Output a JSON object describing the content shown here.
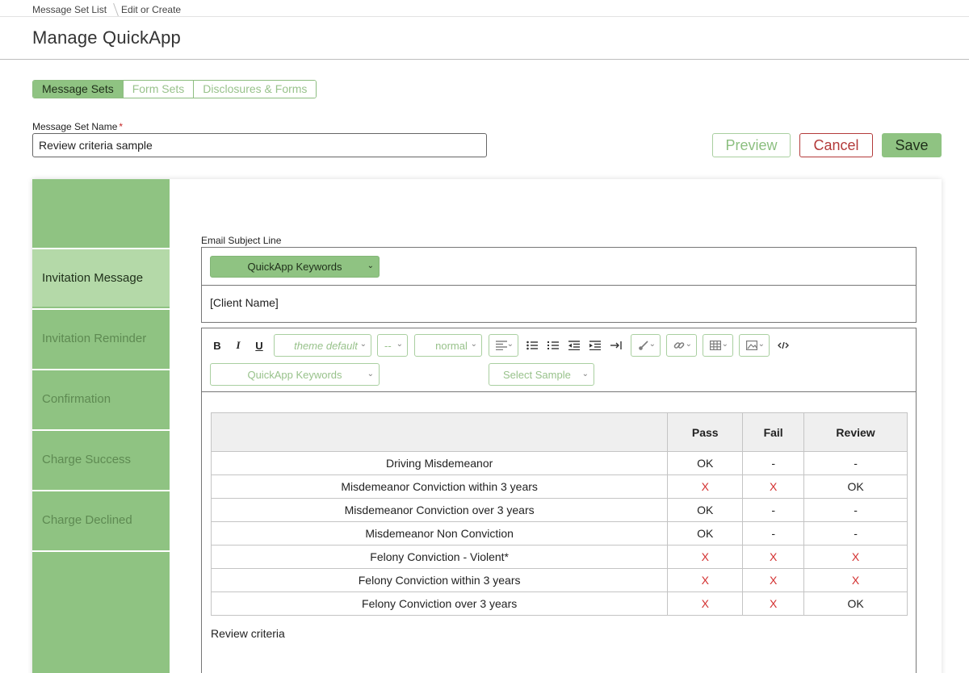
{
  "breadcrumb": {
    "items": [
      "Message Set List",
      "Edit or Create"
    ]
  },
  "page": {
    "title": "Manage QuickApp"
  },
  "tabs": [
    {
      "label": "Message Sets",
      "active": true
    },
    {
      "label": "Form Sets",
      "active": false
    },
    {
      "label": "Disclosures & Forms",
      "active": false
    }
  ],
  "form": {
    "name_label": "Message Set Name",
    "required_mark": "*",
    "name_value": "Review criteria sample"
  },
  "actions": {
    "preview": "Preview",
    "cancel": "Cancel",
    "save": "Save"
  },
  "sidebar": {
    "items": [
      {
        "label": "Invitation Message",
        "active": true
      },
      {
        "label": "Invitation Reminder",
        "active": false
      },
      {
        "label": "Confirmation",
        "active": false
      },
      {
        "label": "Charge Success",
        "active": false
      },
      {
        "label": "Charge Declined",
        "active": false
      }
    ]
  },
  "subject": {
    "label": "Email Subject Line",
    "keywords_dropdown": "QuickApp Keywords",
    "value": "[Client Name]"
  },
  "editor": {
    "toolbar": {
      "bold": "B",
      "italic": "I",
      "underline": "U",
      "font_select": "theme default",
      "size_select": "--",
      "weight_select": "normal",
      "keywords_dropdown": "QuickApp Keywords",
      "sample_dropdown": "Select Sample"
    },
    "table": {
      "headers": [
        "",
        "Pass",
        "Fail",
        "Review"
      ],
      "rows": [
        [
          "Driving Misdemeanor",
          "OK",
          "-",
          "-"
        ],
        [
          "Misdemeanor Conviction within 3 years",
          "X",
          "X",
          "OK"
        ],
        [
          "Misdemeanor Conviction over 3 years",
          "OK",
          "-",
          "-"
        ],
        [
          "Misdemeanor Non Conviction",
          "OK",
          "-",
          "-"
        ],
        [
          "Felony Conviction - Violent*",
          "X",
          "X",
          "X"
        ],
        [
          "Felony Conviction within 3 years",
          "X",
          "X",
          "X"
        ],
        [
          "Felony Conviction over 3 years",
          "X",
          "X",
          "OK"
        ]
      ]
    },
    "caption": "Review criteria"
  },
  "colors": {
    "accent_green": "#8fc382",
    "active_side_green": "#b4d9a8",
    "cancel_red": "#b33a3a",
    "x_red": "#d32f2f"
  }
}
